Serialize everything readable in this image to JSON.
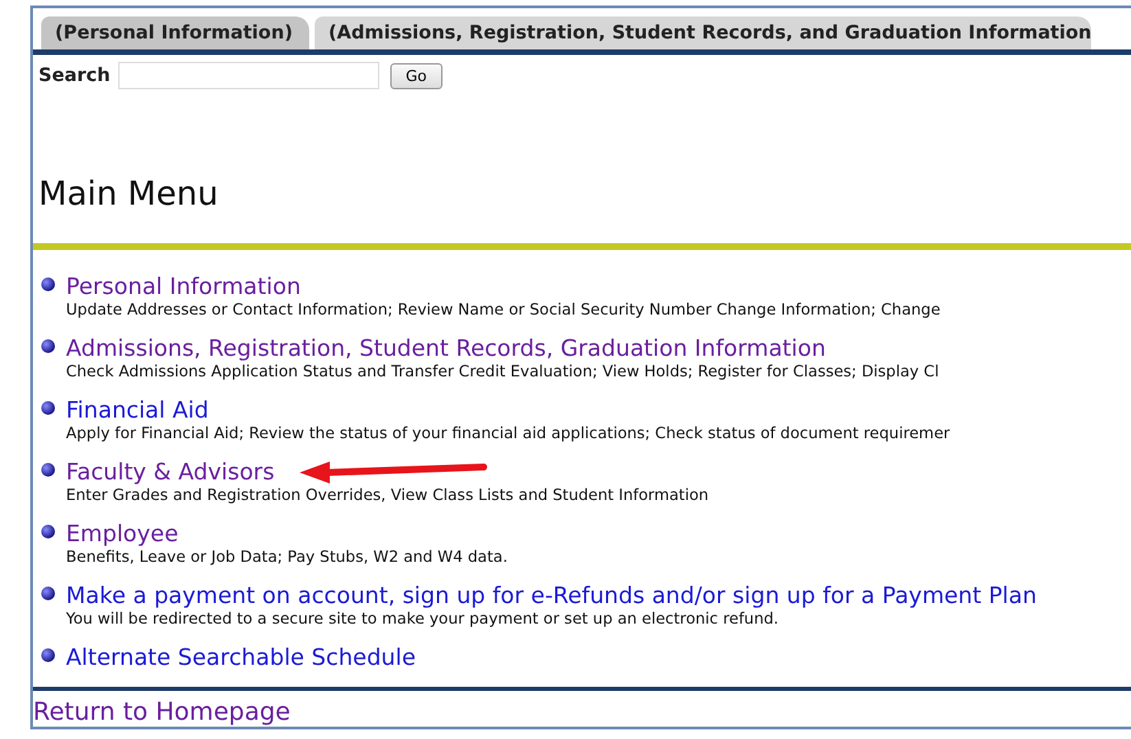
{
  "tabs": [
    {
      "label": "(Personal Information)",
      "selected": true
    },
    {
      "label": "(Admissions, Registration, Student Records, and Graduation Information",
      "selected": false
    }
  ],
  "search": {
    "label": "Search",
    "button": "Go"
  },
  "title": "Main Menu",
  "menu": [
    {
      "title": "Personal Information",
      "visited": true,
      "description": "Update Addresses or Contact Information; Review Name or Social Security Number Change Information; Change"
    },
    {
      "title": "Admissions, Registration, Student Records, Graduation Information",
      "visited": true,
      "description": "Check Admissions Application Status and Transfer Credit Evaluation; View Holds; Register for Classes; Display Cl"
    },
    {
      "title": "Financial Aid",
      "visited": false,
      "description": "Apply for Financial Aid; Review the status of your financial aid applications; Check status of document requiremer"
    },
    {
      "title": "Faculty & Advisors",
      "visited": true,
      "description": "Enter Grades and Registration Overrides, View Class Lists and Student Information"
    },
    {
      "title": "Employee",
      "visited": true,
      "description": "Benefits, Leave or Job Data; Pay Stubs, W2 and W4 data."
    },
    {
      "title": "Make a payment on account, sign up for e-Refunds and/or sign up for a Payment Plan",
      "visited": false,
      "description": "You will be redirected to a secure site to make your payment or set up an electronic refund."
    },
    {
      "title": "Alternate Searchable Schedule",
      "visited": false
    }
  ],
  "footer_link": {
    "label": "Return to Homepage",
    "visited": true
  }
}
